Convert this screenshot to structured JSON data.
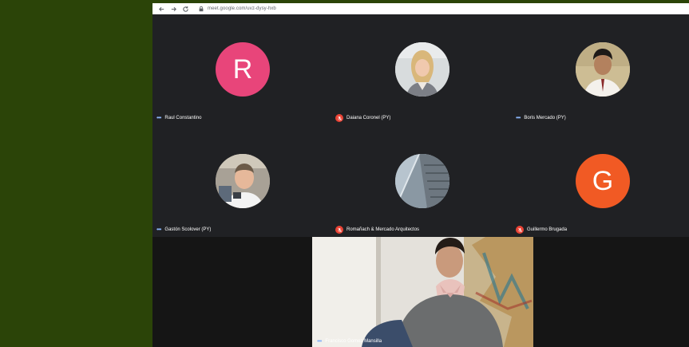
{
  "browser": {
    "url": "meet.google.com/uvz-dysy-hxb",
    "back_icon": "back-arrow-icon",
    "forward_icon": "forward-arrow-icon",
    "reload_icon": "reload-icon"
  },
  "participants": [
    {
      "name": "Raul Constantino",
      "status": "speaking-dots",
      "avatar": "R",
      "avatar_color": "#e8457a"
    },
    {
      "name": "Daiana Coronel (PY)",
      "status": "muted",
      "avatar": "photo"
    },
    {
      "name": "Boris Mercado (PY)",
      "status": "speaking-dots",
      "avatar": "photo"
    },
    {
      "name": "Gastón Scolover (PY)",
      "status": "speaking-dots",
      "avatar": "photo"
    },
    {
      "name": "Romañach & Mercado Arquitectos",
      "status": "muted",
      "avatar": "photo"
    },
    {
      "name": "Guillermo Brugada",
      "status": "muted",
      "avatar": "G",
      "avatar_color": "#f15a24"
    }
  ],
  "main_video": {
    "name": "Francisco Gomez Mansilla"
  },
  "colors": {
    "outer_bg": "#2b4408",
    "meet_bg": "#202124",
    "muted_red": "#ea4335",
    "dots_blue": "#8ab4f8"
  }
}
